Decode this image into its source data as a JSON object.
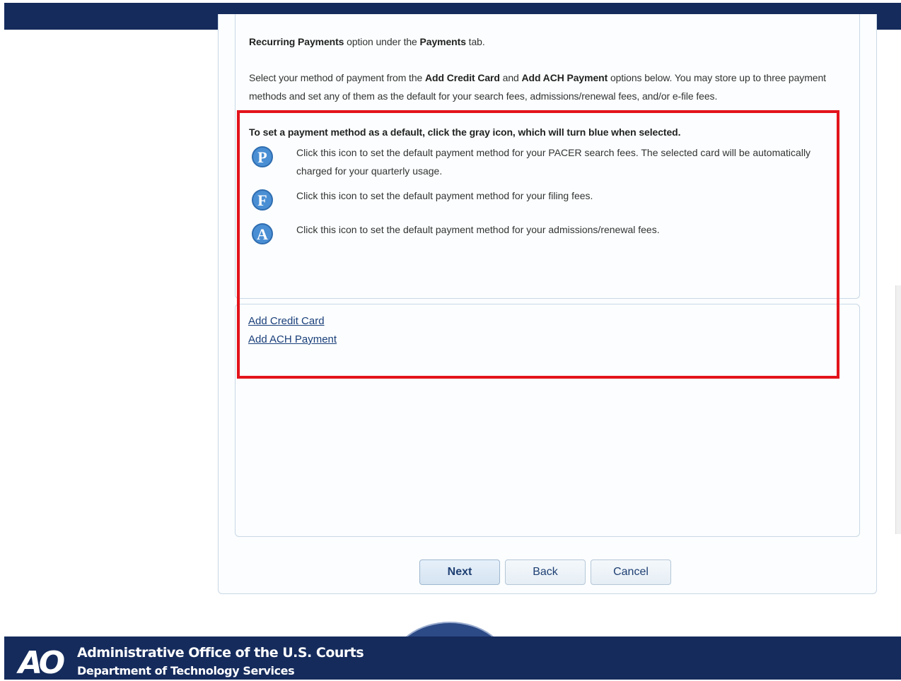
{
  "content": {
    "intro_line1_bold1": "Recurring Payments",
    "intro_line1_mid": " option under the ",
    "intro_line1_bold2": "Payments",
    "intro_line1_end": " tab.",
    "intro2_start": "Select your method of payment from the ",
    "intro2_bold1": "Add Credit Card",
    "intro2_mid": " and ",
    "intro2_bold2": "Add ACH Payment",
    "intro2_end": " options below. You may store up to three payment methods and set any of them as the default for your search fees, admissions/renewal fees, and/or e-file fees.",
    "default_heading": "To set a payment method as a default, click the gray icon, which will turn blue when selected.",
    "icons": [
      {
        "letter": "P",
        "icon": "pacer-default-icon",
        "text": "Click this icon to set the default payment method for your PACER search fees. The selected card will be automatically charged for your quarterly usage."
      },
      {
        "letter": "F",
        "icon": "filing-default-icon",
        "text": "Click this icon to set the default payment method for your filing fees."
      },
      {
        "letter": "A",
        "icon": "admissions-default-icon",
        "text": "Click this icon to set the default payment method for your admissions/renewal fees."
      }
    ]
  },
  "links": {
    "add_credit_card": "Add Credit Card",
    "add_ach_payment": "Add ACH Payment"
  },
  "buttons": {
    "next": "Next",
    "back": "Back",
    "cancel": "Cancel"
  },
  "footer": {
    "logo": "AO",
    "org": "Administrative Office of the U.S. Courts",
    "dept": "Department of Technology Services"
  },
  "colors": {
    "header_bg": "#152b5c",
    "highlight_border": "#e3141b",
    "badge_blue": "#4a8fd4",
    "link": "#1a3f7a"
  }
}
